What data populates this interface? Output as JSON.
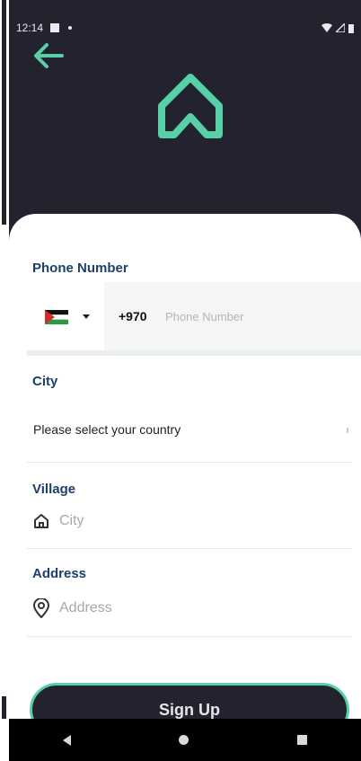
{
  "status": {
    "time": "12:14"
  },
  "phone": {
    "label": "Phone Number",
    "dial_code": "+970",
    "placeholder": "Phone Number",
    "flag": "palestine-flag"
  },
  "city": {
    "label": "City",
    "selected": "Please select your country"
  },
  "village": {
    "label": "Village",
    "placeholder": "City"
  },
  "address": {
    "label": "Address",
    "placeholder": "Address"
  },
  "signup": {
    "label": "Sign Up"
  },
  "colors": {
    "header_bg": "#232330",
    "accent": "#57d0a8",
    "label_blue": "#1c3f6b"
  },
  "icons": {
    "back": "arrow-left-icon",
    "logo": "house-logo-icon",
    "village": "home-icon",
    "address": "location-pin-icon"
  }
}
